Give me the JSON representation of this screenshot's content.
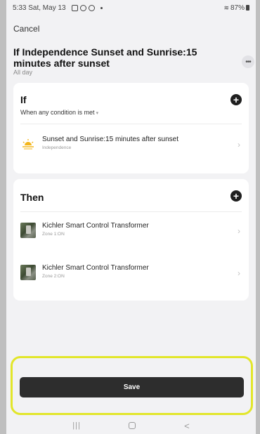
{
  "status_bar": {
    "time_date": "5:33  Sat, May 13",
    "battery": "87%",
    "icons": [
      "notification-icon",
      "notification-icon",
      "settings-icon",
      "dot-icon",
      "wifi-icon",
      "battery-icon"
    ]
  },
  "header": {
    "cancel_label": "Cancel",
    "title": "If Independence Sunset and Sunrise:15 minutes after sunset",
    "subtitle": "All day",
    "more_icon": "more-horizontal-icon"
  },
  "if_section": {
    "heading": "If",
    "condition_hint": "When any condition is met",
    "add_icon": "add-circle-icon",
    "conditions": [
      {
        "title": "Sunset and Sunrise:15 minutes after sunset",
        "subtitle": "Independence",
        "icon": "sunset-icon"
      }
    ]
  },
  "then_section": {
    "heading": "Then",
    "add_icon": "add-circle-icon",
    "actions": [
      {
        "title": "Kichler Smart Control Transformer",
        "subtitle": "Zone 1:ON",
        "icon": "device-thumbnail"
      },
      {
        "title": "Kichler Smart Control Transformer",
        "subtitle": "Zone 2:ON",
        "icon": "device-thumbnail"
      }
    ]
  },
  "footer": {
    "save_label": "Save",
    "highlight_color": "#e2e62a"
  },
  "nav_bar": {
    "recent_label": "|||",
    "back_label": "<"
  }
}
